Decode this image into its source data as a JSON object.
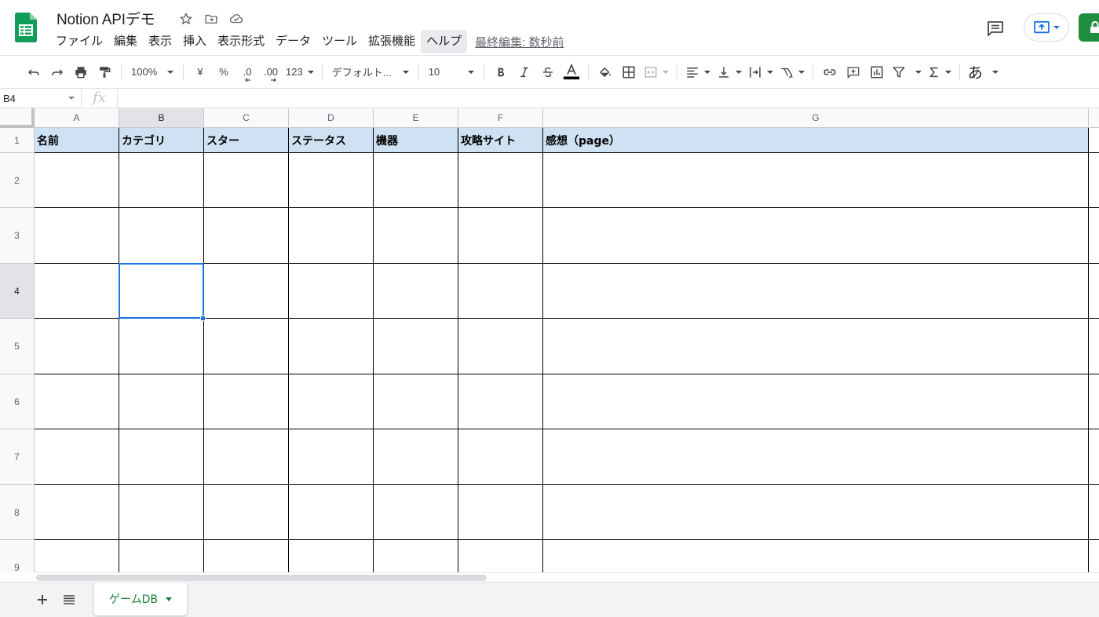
{
  "app": {
    "doc_title": "Notion APIデモ",
    "last_edit": "最終編集: 数秒前",
    "brand_color": "#0f9d58",
    "share_color": "#1e8e3e"
  },
  "menu": [
    "ファイル",
    "編集",
    "表示",
    "挿入",
    "表示形式",
    "データ",
    "ツール",
    "拡張機能",
    "ヘルプ"
  ],
  "toolbar": {
    "zoom": "100%",
    "currency": "¥",
    "percent": "%",
    "decrease_decimal": ".0",
    "increase_decimal": ".00",
    "more_formats": "123",
    "font": "デフォルト...",
    "font_size": "10",
    "input_tool": "あ"
  },
  "formula_bar": {
    "cell_ref": "B4",
    "fx": "fx",
    "value": ""
  },
  "grid": {
    "columns": [
      "A",
      "B",
      "C",
      "D",
      "E",
      "F",
      "G"
    ],
    "selected_column": "B",
    "rows": [
      "1",
      "2",
      "3",
      "4",
      "5",
      "6",
      "7",
      "8",
      "9"
    ],
    "selected_row": "4",
    "header_cells": [
      "名前",
      "カテゴリ",
      "スター",
      "ステータス",
      "機器",
      "攻略サイト",
      "感想（page）"
    ],
    "header_fill": "#cfe2f3",
    "active_cell": "B4"
  },
  "sheets": {
    "active_tab": "ゲームDB"
  }
}
